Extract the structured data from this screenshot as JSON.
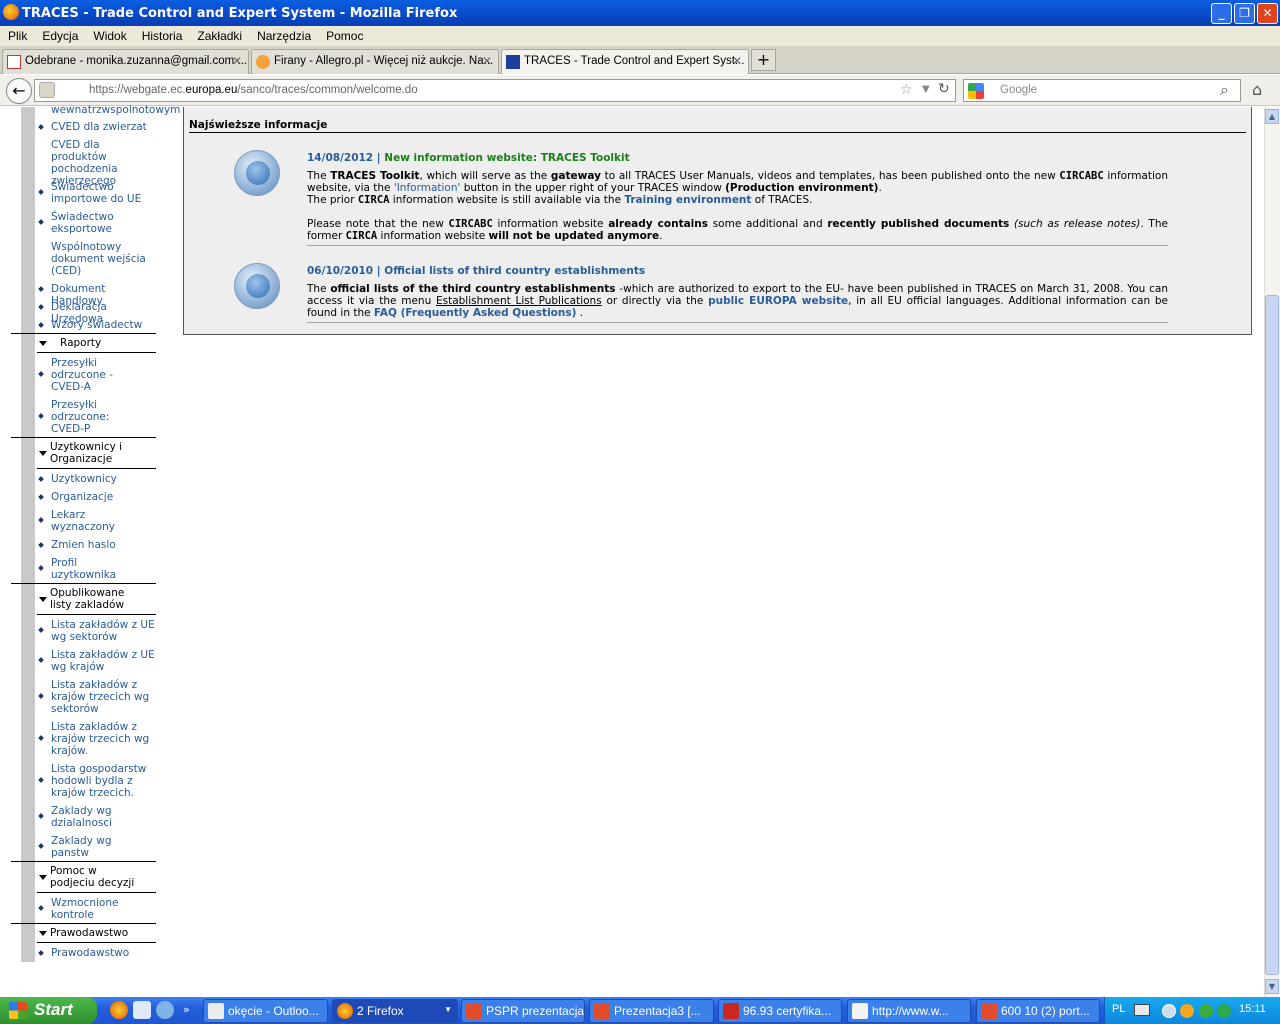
{
  "window": {
    "title": "TRACES - Trade Control and Expert System - Mozilla Firefox",
    "min": "_",
    "max": "❐",
    "close": "✕"
  },
  "menu": [
    "Plik",
    "Edycja",
    "Widok",
    "Historia",
    "Zakładki",
    "Narzędzia",
    "Pomoc"
  ],
  "tabs": [
    {
      "label": "Odebrane - monika.zuzanna@gmail.com ...",
      "close": "✕"
    },
    {
      "label": "Firany - Allegro.pl - Więcej niż aukcje. Na...",
      "close": "✕"
    },
    {
      "label": "TRACES - Trade Control and Expert Syst...",
      "close": "✕"
    }
  ],
  "newtab": "+",
  "nav": {
    "url_prefix": "https://webgate.ec.",
    "url_domain": "europa.eu",
    "url_suffix": "/sanco/traces/common/welcome.do",
    "search_placeholder": "Google"
  },
  "sidebar": {
    "top_items": [
      "wewnatrzwspolnotowym",
      "CVED dla zwierzat",
      "CVED dla produktów pochodzenia zwierzęcego",
      "Świadectwo importowe do UE",
      "Świadectwo eksportowe",
      "Wspólnotowy dokument wejścia (CED)",
      "Dokument Handlowy",
      "Deklaracja Urzędowa",
      "Wzory świadectw"
    ],
    "sections": [
      {
        "title": "Raporty",
        "items": [
          "Przesyłki odrzucone - CVED-A",
          "Przesyłki odrzucone: CVED-P"
        ]
      },
      {
        "title": "Uzytkownicy i Organizacje",
        "items": [
          "Uzytkownicy",
          "Organizacje",
          "Lekarz wyznaczony",
          "Zmien haslo",
          "Profil uzytkownika"
        ]
      },
      {
        "title": "Opublikowane listy zakladów",
        "items": [
          "Lista zakładów z UE wg sektorów",
          "Lista zakładów z UE wg krajów",
          "Lista zakładów z krajów trzecich wg sektorów",
          "Lista zakladów z krajów trzecich wg krajów.",
          "Lista gospodarstw hodowli bydla z krajów trzecich.",
          "Zaklady wg dzialalnosci",
          "Zaklady wg panstw"
        ]
      },
      {
        "title": "Pomoc w podjeciu decyzji",
        "items": [
          "Wzmocnione kontrole"
        ]
      },
      {
        "title": "Prawodawstwo",
        "items": [
          "Prawodawstwo"
        ]
      }
    ]
  },
  "news": {
    "header": "Najświeższe informacje",
    "item1": {
      "date": "14/08/2012",
      "sep": " | ",
      "title": "New information website: TRACES Toolkit",
      "p1_a": "The ",
      "p1_b": "TRACES Toolkit",
      "p1_c": ", which will serve as the ",
      "p1_d": "gateway",
      "p1_e": " to all TRACES User Manuals, videos and templates, has been published onto the new ",
      "p1_f": "CIRCABC",
      "p1_g": " information website, via the ",
      "p1_h": "'Information'",
      "p1_i": " button in the upper right of your TRACES window ",
      "p1_j": "(Production environment)",
      "p1_k": ".",
      "p2_a": "The prior ",
      "p2_b": "CIRCA",
      "p2_c": " information website is still available via the ",
      "p2_d": "Training environment",
      "p2_e": " of TRACES.",
      "p3_a": "Please note that the new ",
      "p3_b": "CIRCABC",
      "p3_c": " information website ",
      "p3_d": "already contains",
      "p3_e": " some additional and ",
      "p3_f": "recently published documents",
      "p3_g": " (such as release notes)",
      "p3_h": ". The former ",
      "p3_i": "CIRCA",
      "p3_j": " information website ",
      "p3_k": "will not be updated anymore",
      "p3_l": "."
    },
    "item2": {
      "date": "06/10/2010",
      "sep": " | ",
      "title": "Official lists of third country establishments",
      "p1_a": "The ",
      "p1_b": "official lists of the third country establishments",
      "p1_c": " -which are authorized to export to the EU- have been published in TRACES on March 31, 2008. You can access it via the menu ",
      "p1_d": "Establishment List Publications",
      "p1_e": " or directly via the ",
      "p1_f": "public EUROPA website",
      "p1_g": ", in all EU official languages. Additional information can be found in the ",
      "p1_h": "FAQ (Frequently Asked Questions)",
      "p1_i": " ."
    }
  },
  "taskbar": {
    "start": "Start",
    "tasks": [
      "okęcie - Outloo...",
      "2 Firefox",
      "PSPR prezentacja",
      "Prezentacja3 [...",
      "96.93 certyfika...",
      "http://www.w...",
      "600 10 (2) port..."
    ],
    "lang": "PL",
    "clock": "15:11"
  }
}
